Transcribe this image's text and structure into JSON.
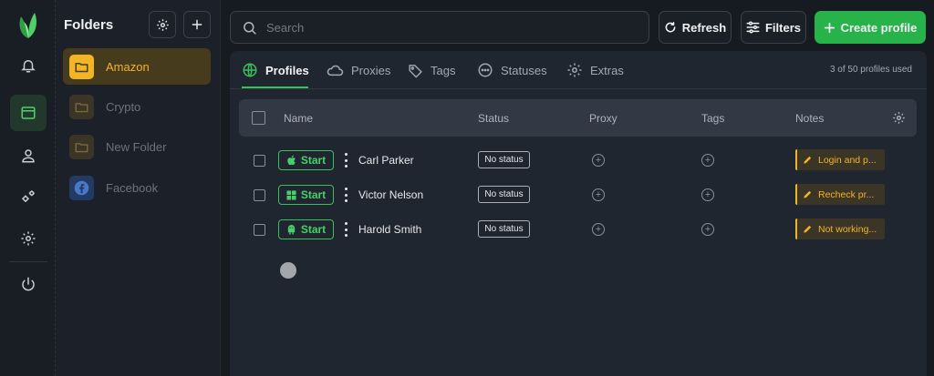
{
  "rail": {
    "items": [
      {
        "name": "bell-icon"
      },
      {
        "name": "browser-window-icon",
        "active": true
      },
      {
        "name": "user-icon"
      },
      {
        "name": "cogs-icon"
      },
      {
        "name": "gear-icon"
      },
      {
        "name": "power-icon"
      }
    ]
  },
  "folders": {
    "title": "Folders",
    "items": [
      {
        "label": "Amazon",
        "icon": "folder-icon",
        "active": true
      },
      {
        "label": "Crypto",
        "icon": "folder-icon"
      },
      {
        "label": "New Folder",
        "icon": "folder-icon"
      },
      {
        "label": "Facebook",
        "icon": "facebook-icon"
      }
    ]
  },
  "topbar": {
    "search_placeholder": "Search",
    "refresh_label": "Refresh",
    "filters_label": "Filters",
    "create_label": "Create profile"
  },
  "tabs": [
    {
      "label": "Profiles",
      "icon": "globe-icon",
      "active": true
    },
    {
      "label": "Proxies",
      "icon": "cloud-icon"
    },
    {
      "label": "Tags",
      "icon": "tag-icon"
    },
    {
      "label": "Statuses",
      "icon": "dots-circle-icon"
    },
    {
      "label": "Extras",
      "icon": "gear-icon"
    }
  ],
  "usage": "3 of 50 profiles used",
  "table": {
    "columns": [
      "Name",
      "Status",
      "Proxy",
      "Tags",
      "Notes"
    ],
    "rows": [
      {
        "start": "Start",
        "os": "apple-icon",
        "name": "Carl Parker",
        "status": "No status",
        "note": "Login and p..."
      },
      {
        "start": "Start",
        "os": "windows-icon",
        "name": "Victor Nelson",
        "status": "No status",
        "note": "Recheck pr..."
      },
      {
        "start": "Start",
        "os": "android-icon",
        "name": "Harold Smith",
        "status": "No status",
        "note": "Not working..."
      }
    ]
  },
  "colors": {
    "accent": "#3bbf5a",
    "folder_active": "#f2b526",
    "background": "#161a21"
  }
}
